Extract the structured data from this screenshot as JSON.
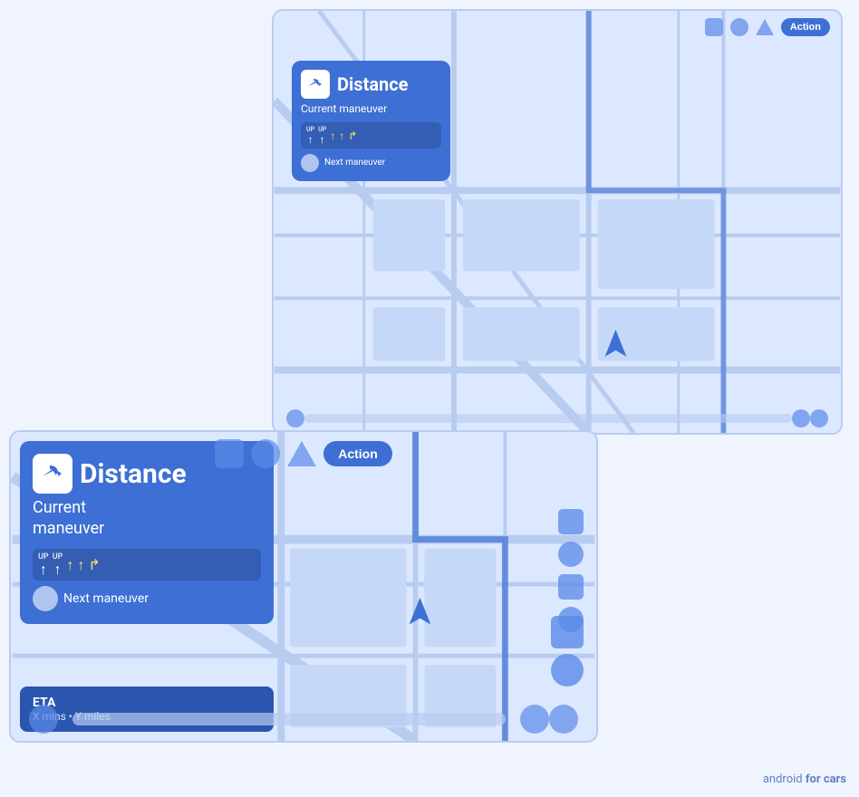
{
  "small_screen": {
    "nav_card": {
      "distance": "Distance",
      "maneuver": "Current maneuver",
      "lanes": [
        {
          "label": "UP",
          "arrow": "↑",
          "highlighted": false
        },
        {
          "label": "UP",
          "arrow": "↑",
          "highlighted": false
        },
        {
          "label": "",
          "arrow": "↑",
          "highlighted": true
        },
        {
          "label": "",
          "arrow": "↑",
          "highlighted": true
        },
        {
          "label": "",
          "arrow": "↱",
          "highlighted": true
        }
      ],
      "next_maneuver": "Next maneuver"
    },
    "action_button": "Action",
    "icons": {
      "square": "square-icon",
      "circle": "circle-icon",
      "triangle": "triangle-icon"
    }
  },
  "large_screen": {
    "nav_card": {
      "distance": "Distance",
      "maneuver": "Current\nmaneuver",
      "lanes": [
        {
          "label": "UP",
          "arrow": "↑",
          "highlighted": false
        },
        {
          "label": "UP",
          "arrow": "↑",
          "highlighted": false
        },
        {
          "label": "",
          "arrow": "↑",
          "highlighted": true
        },
        {
          "label": "",
          "arrow": "↑",
          "highlighted": true
        },
        {
          "label": "",
          "arrow": "↱",
          "highlighted": true
        }
      ],
      "next_maneuver": "Next maneuver"
    },
    "eta": {
      "label": "ETA",
      "detail": "X mins • Y miles"
    },
    "action_button": "Action",
    "icons": {
      "square": "square-icon",
      "circle": "circle-icon",
      "triangle": "triangle-icon"
    },
    "right_icons": [
      {
        "type": "square",
        "name": "map-control-square-1"
      },
      {
        "type": "circle",
        "name": "map-control-circle-1"
      },
      {
        "type": "square",
        "name": "map-control-square-2"
      },
      {
        "type": "circle",
        "name": "map-control-circle-2"
      }
    ],
    "mini_icons_bottom_right": [
      {
        "type": "square",
        "name": "mini-square-1"
      },
      {
        "type": "circle",
        "name": "mini-circle-1"
      }
    ]
  },
  "watermark": {
    "text_normal": "android ",
    "text_bold": "for cars"
  },
  "colors": {
    "brand_blue": "#3d6fd4",
    "map_bg": "#dce8ff",
    "card_bg": "#3d6fd4",
    "icon_blue": "#5a8ae8"
  }
}
